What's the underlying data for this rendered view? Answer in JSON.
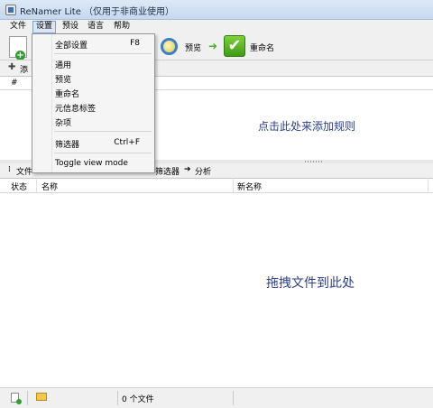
{
  "window": {
    "title": "ReNamer Lite （仅用于非商业使用）"
  },
  "menubar": {
    "items": [
      {
        "label": "文件"
      },
      {
        "label": "设置"
      },
      {
        "label": "预设"
      },
      {
        "label": "语言"
      },
      {
        "label": "帮助"
      }
    ]
  },
  "toolbar": {
    "preview_label": "预览",
    "rename_label": "重命名"
  },
  "rules": {
    "add_label": "添",
    "hash_header": "#",
    "hint": "点击此处来添加规则"
  },
  "files_toolbar": {
    "files_label": "文件",
    "filters_label": "筛选器",
    "analyze_label": "分析"
  },
  "files": {
    "columns": {
      "status": "状态",
      "name": "名称",
      "new_name": "新名称"
    },
    "hint": "拖拽文件到此处"
  },
  "statusbar": {
    "count": "0 个文件"
  },
  "settings_menu": {
    "items": [
      {
        "label": "全部设置",
        "shortcut": "F8"
      },
      {
        "label": "通用",
        "shortcut": ""
      },
      {
        "label": "预览",
        "shortcut": ""
      },
      {
        "label": "重命名",
        "shortcut": ""
      },
      {
        "label": "元信息标签",
        "shortcut": ""
      },
      {
        "label": "杂项",
        "shortcut": ""
      },
      {
        "label": "筛选器",
        "shortcut": "Ctrl+F"
      },
      {
        "label": "Toggle view mode",
        "shortcut": ""
      }
    ]
  }
}
